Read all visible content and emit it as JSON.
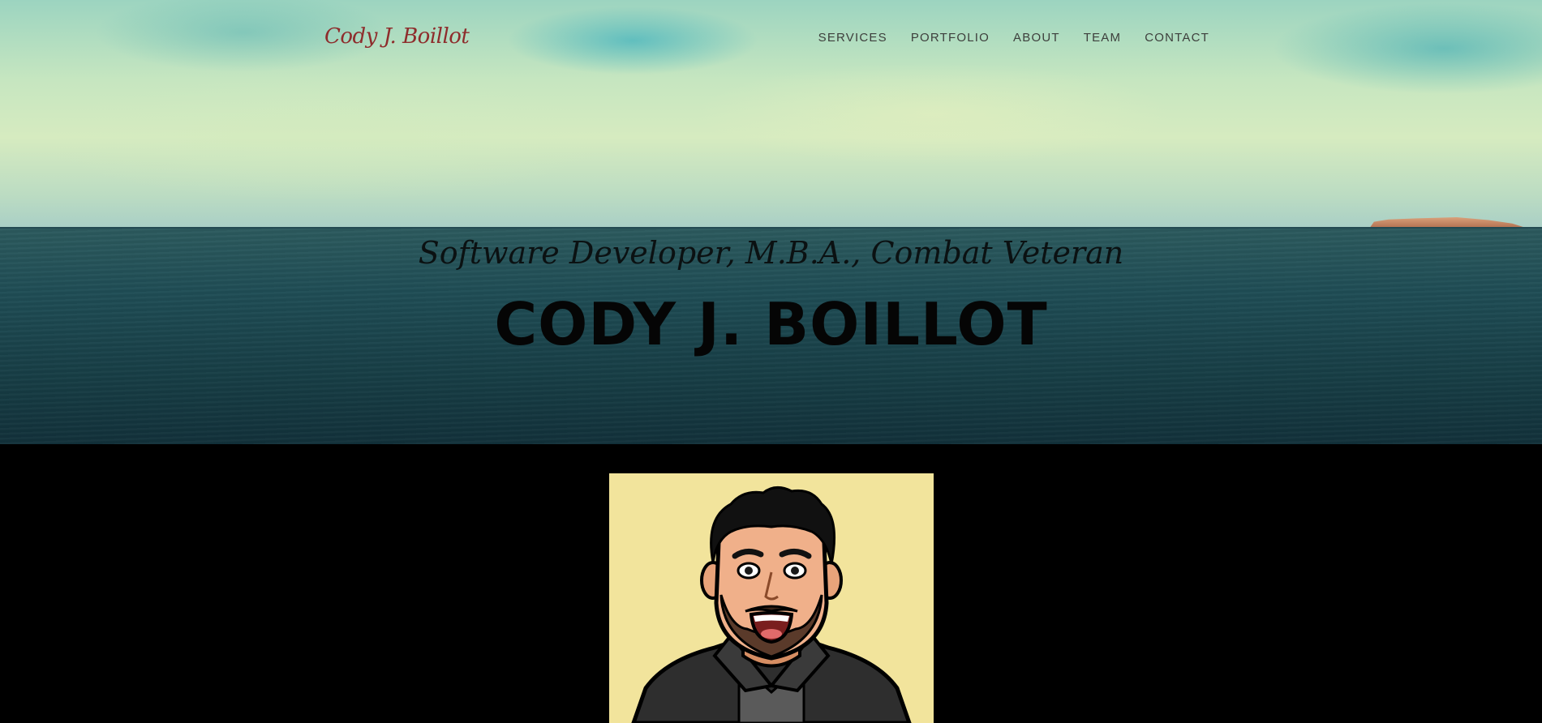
{
  "brand": {
    "name": "Cody J. Boillot"
  },
  "nav": {
    "items": [
      {
        "label": "SERVICES"
      },
      {
        "label": "PORTFOLIO"
      },
      {
        "label": "ABOUT"
      },
      {
        "label": "TEAM"
      },
      {
        "label": "CONTACT"
      }
    ]
  },
  "hero": {
    "subtitle": "Software Developer, M.B.A., Combat Veteran",
    "title": "CODY J. BOILLOT"
  },
  "colors": {
    "brand": "#8e2c2c",
    "nav_text": "#3d3f3c",
    "page_background": "#000000",
    "avatar_background": "#f2e49c"
  }
}
